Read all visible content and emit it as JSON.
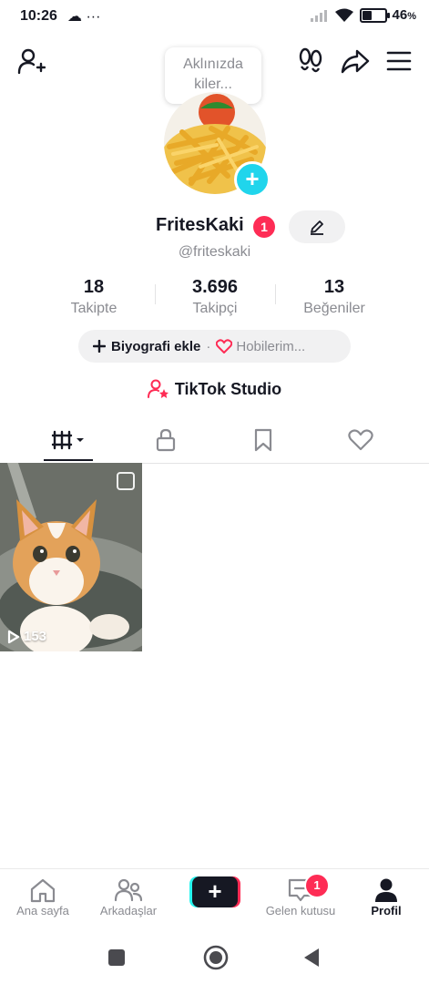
{
  "status_bar": {
    "time": "10:26",
    "notifications": "☁ ···",
    "battery_percent": "46",
    "battery_unit": "%",
    "battery_level": 0.46
  },
  "tooltip": {
    "line1": "Aklınızda",
    "line2": "kiler..."
  },
  "profile": {
    "display_name": "FritesKaki",
    "notification_count": "1",
    "handle": "@friteskaki"
  },
  "stats": [
    {
      "value": "18",
      "label": "Takipte"
    },
    {
      "value": "3.696",
      "label": "Takipçi"
    },
    {
      "value": "13",
      "label": "Beğeniler"
    }
  ],
  "bio": {
    "add_label": "Biyografi ekle",
    "separator": "·",
    "hobbies_label": "Hobilerim..."
  },
  "studio": {
    "label": "TikTok Studio"
  },
  "tabs": [
    {
      "icon": "videos-grid-icon",
      "active": true
    },
    {
      "icon": "lock-icon",
      "active": false
    },
    {
      "icon": "bookmark-icon",
      "active": false
    },
    {
      "icon": "heart-icon",
      "active": false
    }
  ],
  "videos": [
    {
      "views": "153"
    }
  ],
  "bottom_nav": {
    "items": [
      {
        "label": "Ana sayfa",
        "icon": "home-icon"
      },
      {
        "label": "Arkadaşlar",
        "icon": "friends-icon"
      },
      {
        "label": "",
        "icon": "create-plus-icon"
      },
      {
        "label": "Gelen kutusu",
        "icon": "inbox-icon",
        "badge": "1"
      },
      {
        "label": "Profil",
        "icon": "profile-icon",
        "active": true
      }
    ]
  },
  "colors": {
    "accent_red": "#fe2c55",
    "accent_cyan": "#25f4ee",
    "avatar_plus": "#20d5ec",
    "text_primary": "#161823",
    "text_secondary": "#8a8b91"
  }
}
